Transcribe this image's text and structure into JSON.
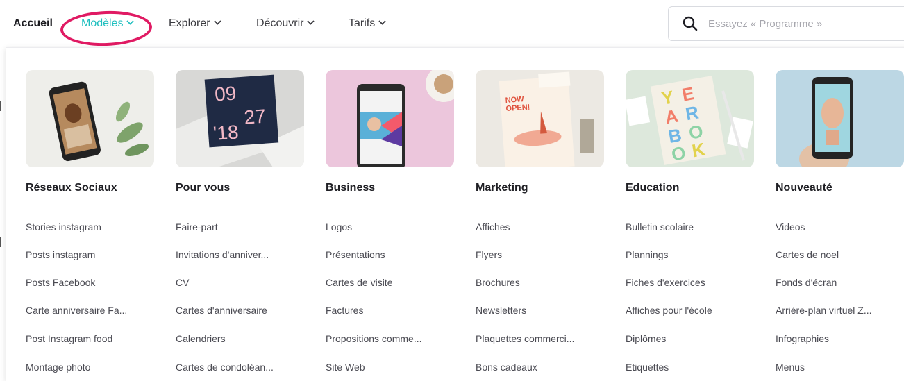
{
  "nav": {
    "home": "Accueil",
    "models": "Modèles",
    "explorer": "Explorer",
    "discover": "Découvrir",
    "pricing": "Tarifs"
  },
  "search": {
    "placeholder": "Essayez « Programme »"
  },
  "accent_color": "#1fbfbf",
  "highlight_color": "#e01a63",
  "columns": [
    {
      "title": "Réseaux Sociaux",
      "thumb_text": "",
      "links": [
        "Stories instagram",
        "Posts instagram",
        "Posts Facebook",
        "Carte anniversaire Fa...",
        "Post Instagram food",
        "Montage photo"
      ]
    },
    {
      "title": "Pour vous",
      "thumb_text": "09 27 '18",
      "links": [
        "Faire-part",
        "Invitations d'anniver...",
        "CV",
        "Cartes d'anniversaire",
        "Calendriers",
        "Cartes de condoléan..."
      ]
    },
    {
      "title": "Business",
      "thumb_text": "",
      "links": [
        "Logos",
        "Présentations",
        "Cartes de visite",
        "Factures",
        "Propositions comme...",
        "Site Web"
      ]
    },
    {
      "title": "Marketing",
      "thumb_text": "NOW OPEN!",
      "links": [
        "Affiches",
        "Flyers",
        "Brochures",
        "Newsletters",
        "Plaquettes commerci...",
        "Bons cadeaux"
      ]
    },
    {
      "title": "Education",
      "thumb_text": "YEARBOOK",
      "links": [
        "Bulletin scolaire",
        "Plannings",
        "Fiches d'exercices",
        "Affiches pour l'école",
        "Diplômes",
        "Etiquettes"
      ]
    },
    {
      "title": "Nouveauté",
      "thumb_text": "",
      "links": [
        "Videos",
        "Cartes de noel",
        "Fonds d'écran",
        "Arrière-plan virtuel Z...",
        "Infographies",
        "Menus"
      ]
    }
  ]
}
